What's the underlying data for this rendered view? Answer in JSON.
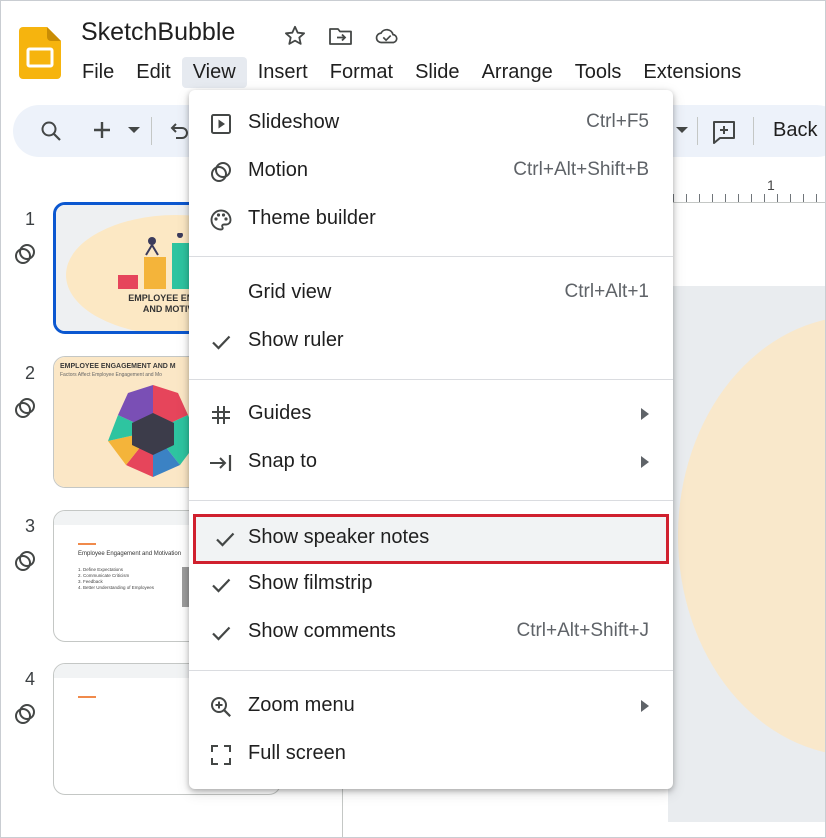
{
  "app": {
    "title": "SketchBubble",
    "logo_color": "#f6b40e"
  },
  "menubar": [
    {
      "label": "File"
    },
    {
      "label": "Edit"
    },
    {
      "label": "View",
      "active": true
    },
    {
      "label": "Insert"
    },
    {
      "label": "Format"
    },
    {
      "label": "Slide"
    },
    {
      "label": "Arrange"
    },
    {
      "label": "Tools"
    },
    {
      "label": "Extensions"
    }
  ],
  "toolbar": {
    "back_label": "Back",
    "icons": [
      "search-icon",
      "add-icon",
      "chevron-down-icon",
      "undo-icon",
      "add-comment-icon"
    ]
  },
  "ruler": {
    "mark": "1"
  },
  "slides": [
    {
      "number": "1",
      "title": "EMPLOYEE ENGAG\nAND MOTIVA"
    },
    {
      "number": "2",
      "title": "EMPLOYEE ENGAGEMENT AND M",
      "subtitle": "Factors Affect Employee Engagement and Mo"
    },
    {
      "number": "3",
      "title": "Employee Engagement and Motivation",
      "list": [
        "1.  Define Expectations",
        "2.  Communicate Criticism",
        "3.  Feedback",
        "4.  Better Understanding of Employees"
      ]
    },
    {
      "number": "4"
    }
  ],
  "view_menu": {
    "items": [
      {
        "label": "Slideshow",
        "shortcut": "Ctrl+F5",
        "icon": "slideshow-icon"
      },
      {
        "label": "Motion",
        "shortcut": "Ctrl+Alt+Shift+B",
        "icon": "motion-icon"
      },
      {
        "label": "Theme builder",
        "shortcut": "",
        "icon": "palette-icon"
      },
      {
        "label": "Grid view",
        "shortcut": "Ctrl+Alt+1",
        "icon": ""
      },
      {
        "label": "Show ruler",
        "shortcut": "",
        "icon": "check-icon",
        "checked": true
      },
      {
        "label": "Guides",
        "shortcut": "",
        "icon": "grid-icon",
        "submenu": true
      },
      {
        "label": "Snap to",
        "shortcut": "",
        "icon": "snap-icon",
        "submenu": true
      },
      {
        "label": "Show speaker notes",
        "shortcut": "",
        "icon": "check-icon",
        "checked": true,
        "highlighted": true
      },
      {
        "label": "Show filmstrip",
        "shortcut": "",
        "icon": "check-icon",
        "checked": true
      },
      {
        "label": "Show comments",
        "shortcut": "Ctrl+Alt+Shift+J",
        "icon": "check-icon",
        "checked": true
      },
      {
        "label": "Zoom menu",
        "shortcut": "",
        "icon": "zoom-icon",
        "submenu": true
      },
      {
        "label": "Full screen",
        "shortcut": "",
        "icon": "fullscreen-icon"
      }
    ],
    "highlight_color": "#d0202e"
  }
}
